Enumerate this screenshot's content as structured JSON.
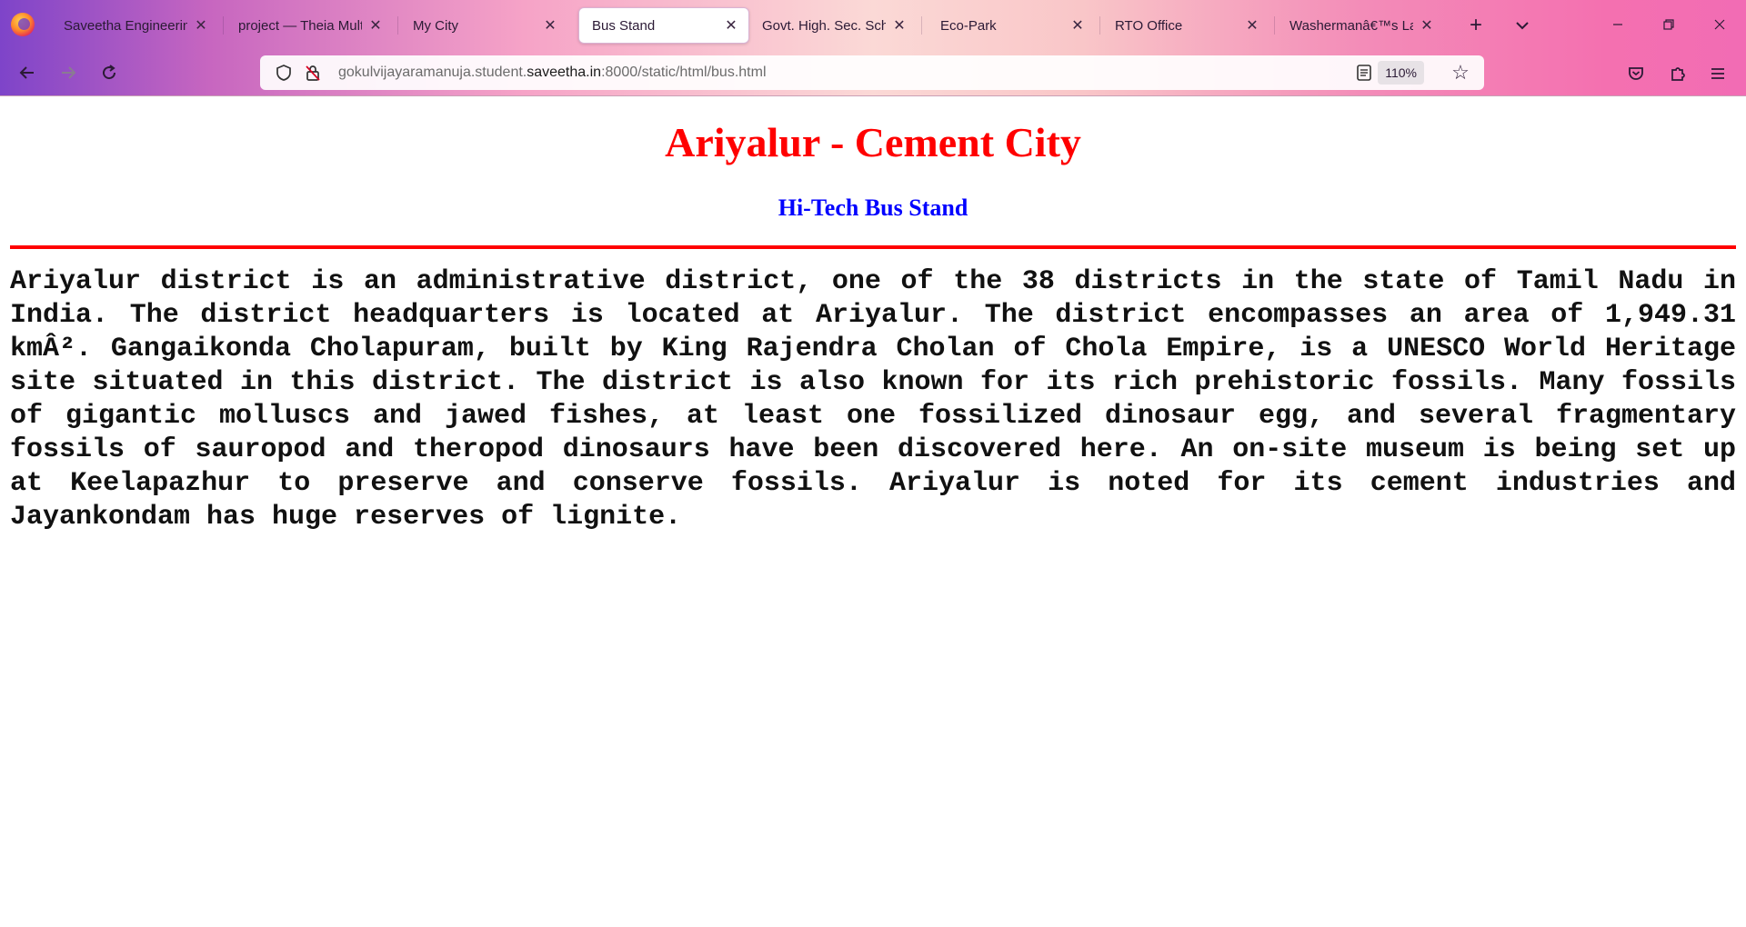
{
  "browser": {
    "tabs": [
      {
        "title": "Saveetha Engineering",
        "active": false
      },
      {
        "title": "project — Theia Multi-",
        "active": false
      },
      {
        "title": "My City",
        "active": false
      },
      {
        "title": "Bus Stand",
        "active": true
      },
      {
        "title": "Govt. High. Sec. Schoo",
        "active": false
      },
      {
        "title": "Eco-Park",
        "active": false
      },
      {
        "title": "RTO Office",
        "active": false
      },
      {
        "title": "Washermanâ€™s Lake",
        "active": false
      }
    ],
    "url_prefix": "gokulvijayaramanuja.student.",
    "url_domain": "saveetha.in",
    "url_suffix": ":8000/static/html/bus.html",
    "zoom": "110%",
    "icons": {
      "back": "back-arrow-icon",
      "forward": "forward-arrow-icon",
      "reload": "reload-icon",
      "shield": "tracking-protection-shield-icon",
      "insecure": "insecure-lock-icon",
      "reader": "reader-view-icon",
      "bookmark": "bookmark-star-icon",
      "pocket": "pocket-icon",
      "extensions": "extensions-puzzle-icon",
      "menu": "hamburger-menu-icon"
    }
  },
  "page": {
    "title": "Ariyalur - Cement City",
    "subtitle": "Hi-Tech Bus Stand",
    "paragraph": "Ariyalur district is an administrative district, one of the 38 districts in the state of Tamil Nadu in India. The district headquarters is located at Ariyalur. The district encompasses an area of 1,949.31 kmÂ². Gangaikonda Cholapuram, built by King Rajendra Cholan of Chola Empire, is a UNESCO World Heritage site situated in this district. The district is also known for its rich prehistoric fossils. Many fossils of gigantic molluscs and jawed fishes, at least one fossilized dinosaur egg, and several fragmentary fossils of sauropod and theropod dinosaurs have been discovered here. An on-site museum is being set up at Keelapazhur to preserve and conserve fossils. Ariyalur is noted for its cement industries and Jayankondam has huge reserves of lignite."
  },
  "colors": {
    "title": "#ff0000",
    "subtitle": "#0000ff",
    "divider": "#ff0000",
    "text": "#111111"
  }
}
